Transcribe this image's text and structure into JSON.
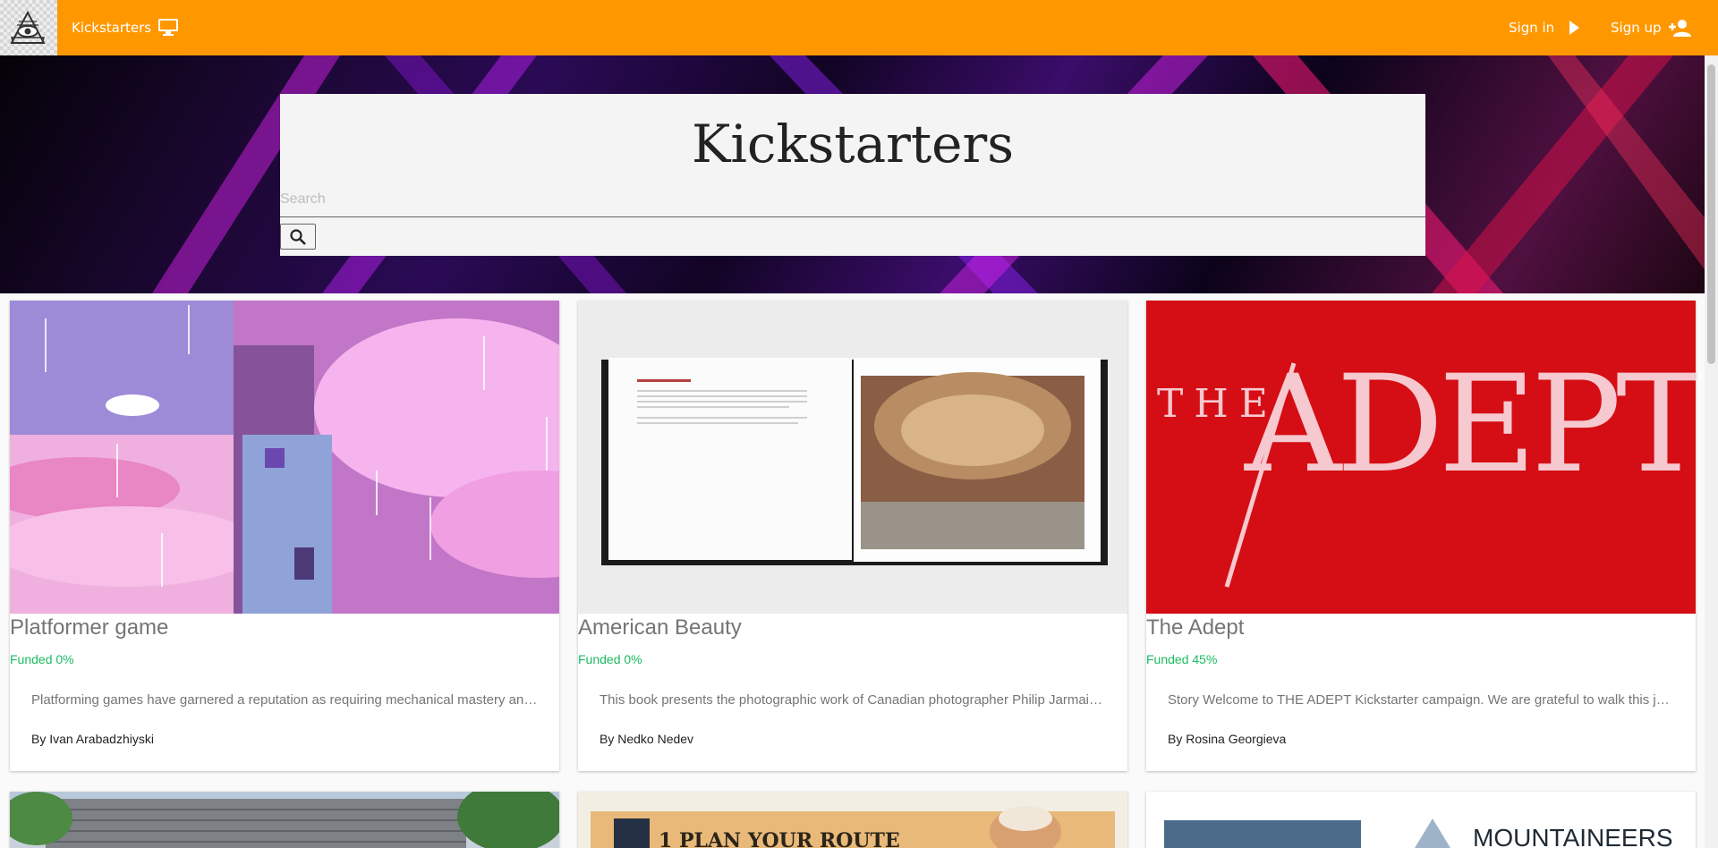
{
  "nav": {
    "brand": "Kickstarters",
    "sign_in": "Sign in",
    "sign_up": "Sign up",
    "brand_icon": "monitor-icon",
    "sign_in_icon": "play-arrow-icon",
    "sign_up_icon": "person-add-icon",
    "accent": "#ff9800"
  },
  "hero": {
    "title": "Kickstarters",
    "search_placeholder": "Search",
    "search_icon": "search-icon"
  },
  "projects": [
    {
      "title": "Platformer game",
      "funded": "Funded 0%",
      "description": "Platforming games have garnered a reputation as requiring mechanical mastery and precise execution that leaves many players behind",
      "author": "By Ivan Arabadzhiyski"
    },
    {
      "title": "American Beauty",
      "funded": "Funded 0%",
      "description": "This book presents the photographic work of Canadian photographer Philip Jarmain who documented the architecture of Detroit",
      "author": "By Nedko Nedev"
    },
    {
      "title": "The Adept",
      "funded": "Funded 45%",
      "description": "Story Welcome to THE ADEPT Kickstarter campaign. We are grateful to walk this journey with you",
      "author": "By Rosina Georgieva"
    }
  ],
  "partial_cards": [
    {
      "caption": "1 PLAN YOUR ROUTE"
    },
    {
      "caption": "MOUNTAINEERS"
    }
  ],
  "funded_color": "#1abc60"
}
